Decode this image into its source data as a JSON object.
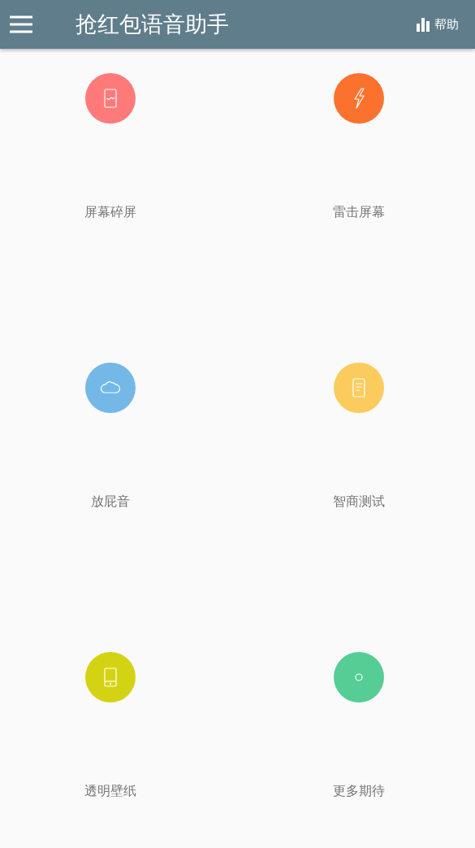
{
  "app_bar": {
    "title": "抢红包语音助手",
    "help": "帮助"
  },
  "items": [
    {
      "label": "屏幕碎屏",
      "kind": "cracked",
      "color": "#fe7a7a"
    },
    {
      "label": "雷击屏幕",
      "kind": "bolt",
      "color": "#fa722e"
    },
    {
      "label": "放屁音",
      "kind": "cloud",
      "color": "#74b8e8"
    },
    {
      "label": "智商测试",
      "kind": "document",
      "color": "#fbcb5d"
    },
    {
      "label": "透明壁纸",
      "kind": "tablet",
      "color": "#d4d313"
    },
    {
      "label": "更多期待",
      "kind": "ring",
      "color": "#55cd95"
    }
  ]
}
